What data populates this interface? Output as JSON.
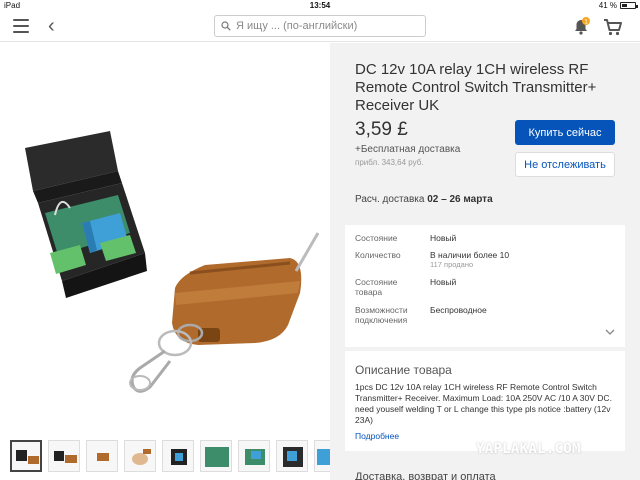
{
  "status_bar": {
    "device": "iPad",
    "time": "13:54",
    "battery": "41 %",
    "battery_level": 0.41
  },
  "header": {
    "search": {
      "placeholder": "Я ищу ... (по-английски)"
    },
    "notification_count": "1",
    "icons": [
      "menu-icon",
      "back-arrow-icon",
      "search-icon",
      "bell-icon",
      "cart-icon"
    ]
  },
  "product": {
    "title": "DC 12v 10A relay 1CH wireless RF Remote Control Switch Transmitter+ Receiver UK",
    "price": "3,59 £",
    "shipping": "+Бесплатная доставка",
    "approx_price": "прибл. 343,64 руб.",
    "buy_label": "Купить сейчас",
    "watch_label": "Не отслеживать",
    "delivery_label": "Расч.  доставка",
    "delivery_dates": "02 – 26 марта"
  },
  "details": {
    "rows": [
      {
        "label": "Состояние",
        "value": "Новый",
        "sub": ""
      },
      {
        "label": "Количество",
        "value": "В наличии более 10",
        "sub": "117 продано"
      },
      {
        "label": "Состояние товара",
        "value": "Новый",
        "sub": ""
      },
      {
        "label": "Возможности подключения",
        "value": "Беспроводное",
        "sub": ""
      }
    ]
  },
  "description": {
    "title": "Описание товара",
    "text": "1pcs DC 12v 10A relay 1CH wireless RF Remote Control Switch Transmitter+ Receiver. Maximum Load: 10A 250V AC /10 A 30V DC. need youself welding T or L change this type pls notice :battery (12v 23A)",
    "more_label": "Подробнее"
  },
  "next_section": {
    "title": "Доставка, возврат и оплата"
  },
  "watermark": "YAPLAKAL.COM",
  "colors": {
    "accent": "#0654ba",
    "badge": "#f5a623",
    "panel": "#f2f2f2"
  }
}
